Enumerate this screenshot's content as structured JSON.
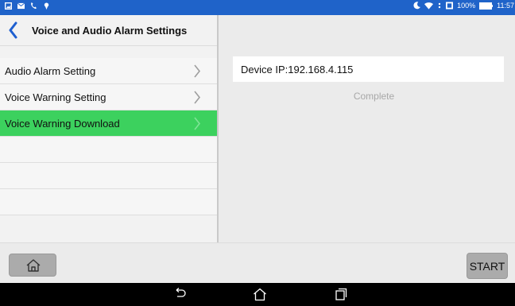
{
  "status_bar": {
    "battery": "100%",
    "time": "11:57"
  },
  "header": {
    "title": "Voice and Audio Alarm Settings"
  },
  "menu": {
    "items": [
      {
        "label": "Audio Alarm Setting",
        "active": false
      },
      {
        "label": "Voice Warning Setting",
        "active": false
      },
      {
        "label": "Voice Warning Download",
        "active": true
      }
    ]
  },
  "right_panel": {
    "device_ip": "Device IP:192.168.4.115",
    "status": "Complete"
  },
  "app_bar": {
    "start_label": "START"
  },
  "colors": {
    "statusbar": "#1f63c9",
    "active_item": "#3cd15e",
    "back_arrow": "#1e5fd0"
  }
}
